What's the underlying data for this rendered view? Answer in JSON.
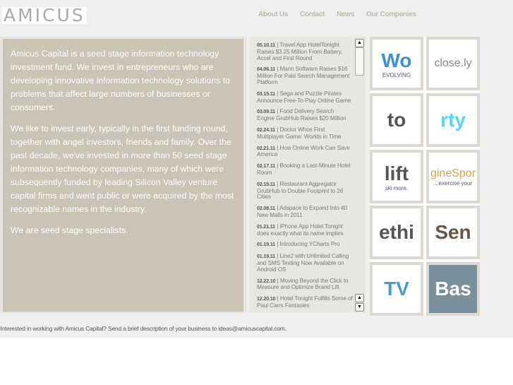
{
  "logo": "AMICUS",
  "nav": [
    "About Us",
    "Contact",
    "News",
    "Our Companies"
  ],
  "intro": [
    "Amicus Capital is a seed stage information technology investment fund. We invest in entrepreneurs who are developing innovative information technology solutions to problems that affect large numbers of businesses or consumers.",
    "We like to invest early, typically in the first funding round, together with angel investors, friends and family.  Over the past decade, we've invested in more than 50 seed stage information technology companies, many of which were subsequently funded by leading Silicon Valley venture capital firms and went public or were acquired by the most recognizable names in the industry.",
    "We are seed stage specialists."
  ],
  "news": [
    {
      "date": "05.10.11",
      "title": "Travel App HotelTonight Raises $3.25 Million From Battery, Accel and First Round"
    },
    {
      "date": "04.06.11",
      "title": "Marin Software Raises $16 Million For Paid Search Management Platform"
    },
    {
      "date": "03.15.11",
      "title": "Sega and Puzzle Pirates Announce Free-To-Play Online Game"
    },
    {
      "date": "03.09.11",
      "title": "Food Delivery Search Engine GrubHub Raises $20 Million"
    },
    {
      "date": "02.24.11",
      "title": "Doctor Whos First Multiplayer Game: Worlds in Time"
    },
    {
      "date": "02.21.11",
      "title": "How Online Work Can Save America"
    },
    {
      "date": "02.17.11",
      "title": "Booking a Last-Minute Hotel Room"
    },
    {
      "date": "02.15.11",
      "title": "Restaurant Aggregator GrubHub to Double Footprint to 26 Cities"
    },
    {
      "date": "02.08.11",
      "title": "Adspace to Expand Into 40 New Malls in 2011"
    },
    {
      "date": "01.21.11",
      "title": "iPhone App Hotel Tonight does exactly what its name implies"
    },
    {
      "date": "01.19.11",
      "title": "Introducing YCharts Pro"
    },
    {
      "date": "01.19.11",
      "title": "Line2 with Unlimited Calling and SMS Texting Now Available on Android OS"
    },
    {
      "date": "12.22.10",
      "title": "Moving Beyond the Click to Measure and Optimize Brand Lift"
    },
    {
      "date": "12.20.10",
      "title": "Hotel Tonight Fulfills Some of Paul Carrs Fantasies"
    }
  ],
  "companies": [
    {
      "text": "Wo",
      "sub": "EVOLVING",
      "color": "#3d8fd8"
    },
    {
      "text": "close.ly",
      "color": "#888"
    },
    {
      "text": "to",
      "color": "#555"
    },
    {
      "text": "rty",
      "color": "#4fd8ff"
    },
    {
      "text": "lift",
      "sub": "ski more.",
      "color": "#555"
    },
    {
      "text": "gineSpor",
      "sub": "...exercise your",
      "color": "#d8a24a"
    },
    {
      "text": "ethi",
      "color": "#555"
    },
    {
      "text": "Sen",
      "color": "#6b5444"
    },
    {
      "text": "TV",
      "color": "#4a9ad8"
    },
    {
      "text": "Bas",
      "color": "#fff"
    }
  ],
  "footer": "Interested in working with Amicus Capital? Send a brief description of your business to ideas@amicuscapital.com."
}
